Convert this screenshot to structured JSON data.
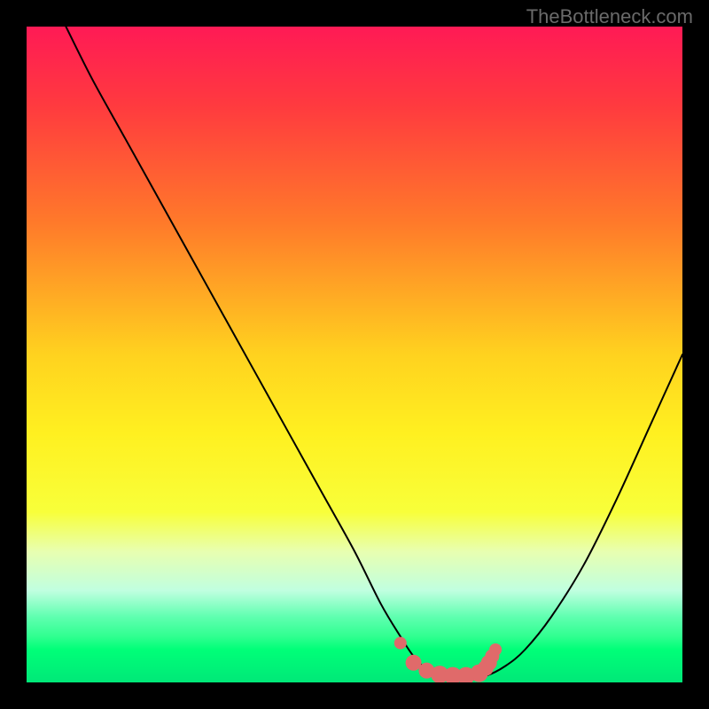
{
  "watermark": "TheBottleneck.com",
  "chart_data": {
    "type": "line",
    "title": "",
    "xlabel": "",
    "ylabel": "",
    "xlim": [
      0,
      100
    ],
    "ylim": [
      0,
      100
    ],
    "background_gradient": {
      "type": "rainbow",
      "stops": [
        {
          "pos": 0.0,
          "color": "#ff1a55"
        },
        {
          "pos": 0.12,
          "color": "#ff3a3f"
        },
        {
          "pos": 0.3,
          "color": "#ff7a2a"
        },
        {
          "pos": 0.5,
          "color": "#ffd21f"
        },
        {
          "pos": 0.62,
          "color": "#fff020"
        },
        {
          "pos": 0.74,
          "color": "#f8ff3a"
        },
        {
          "pos": 0.8,
          "color": "#e8ffb0"
        },
        {
          "pos": 0.86,
          "color": "#c0ffe0"
        },
        {
          "pos": 0.9,
          "color": "#5fffb0"
        },
        {
          "pos": 0.93,
          "color": "#30ff90"
        },
        {
          "pos": 0.95,
          "color": "#00ff78"
        },
        {
          "pos": 1.0,
          "color": "#00e878"
        }
      ]
    },
    "series": [
      {
        "name": "bottleneck-curve",
        "color": "#000000",
        "width": 2,
        "x": [
          6,
          10,
          15,
          20,
          25,
          30,
          35,
          40,
          45,
          50,
          54,
          57,
          59,
          61,
          63,
          65,
          67,
          70,
          73,
          76,
          80,
          85,
          90,
          95,
          100
        ],
        "y": [
          100,
          92,
          83,
          74,
          65,
          56,
          47,
          38,
          29,
          20,
          12,
          7,
          4,
          2,
          1,
          0.7,
          0.7,
          1.0,
          2.5,
          5,
          10,
          18,
          28,
          39,
          50
        ]
      }
    ],
    "highlight": {
      "name": "sweet-spot",
      "color": "#e06a6a",
      "x": [
        57,
        59,
        61,
        63,
        65,
        67,
        69,
        70,
        70.5,
        71,
        71.5
      ],
      "y": [
        6,
        3,
        1.8,
        1.2,
        1.0,
        1.0,
        1.4,
        2.2,
        3.0,
        4.0,
        5.0
      ],
      "marker_r": [
        7,
        9,
        9,
        10,
        10,
        10,
        10,
        9,
        9,
        8,
        7
      ]
    }
  }
}
